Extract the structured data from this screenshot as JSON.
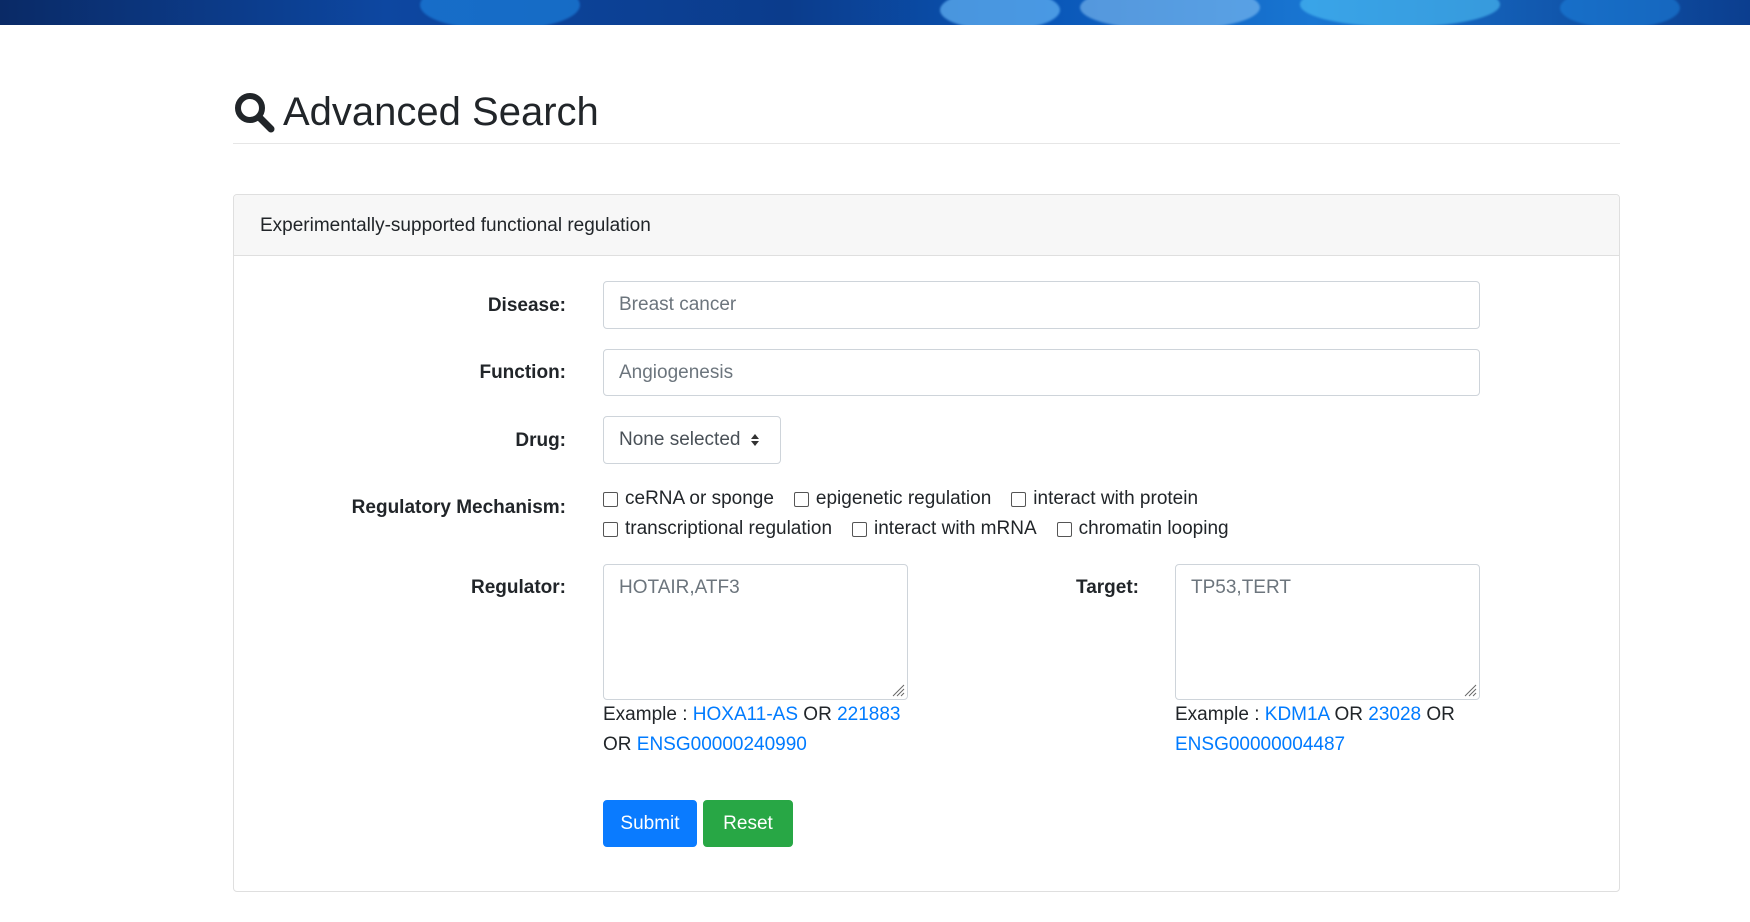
{
  "page": {
    "title": "Advanced Search"
  },
  "card": {
    "header": "Experimentally-supported functional regulation"
  },
  "form": {
    "disease": {
      "label": "Disease:",
      "placeholder": "Breast cancer"
    },
    "function": {
      "label": "Function:",
      "placeholder": "Angiogenesis"
    },
    "drug": {
      "label": "Drug:",
      "selected": "None selected"
    },
    "mechanism": {
      "label": "Regulatory Mechanism:",
      "options": [
        "ceRNA or sponge",
        "epigenetic regulation",
        "interact with protein",
        "transcriptional regulation",
        "interact with mRNA",
        "chromatin looping"
      ]
    },
    "regulator": {
      "label": "Regulator:",
      "placeholder": "HOTAIR,ATF3",
      "example_prefix": "Example : ",
      "examples": [
        "HOXA11-AS",
        "221883",
        "ENSG00000240990"
      ],
      "or": "OR"
    },
    "target": {
      "label": "Target:",
      "placeholder": "TP53,TERT",
      "example_prefix": "Example : ",
      "examples": [
        "KDM1A",
        "23028",
        "ENSG00000004487"
      ],
      "or": "OR"
    },
    "buttons": {
      "submit": "Submit",
      "reset": "Reset"
    }
  },
  "icons": {
    "title_icon": "search-icon",
    "drug_select_caret": "sort-caret-icon"
  },
  "colors": {
    "primary": "#0a7bff",
    "success": "#28a745",
    "link": "#007bff",
    "header_bg": "#f7f7f7"
  }
}
